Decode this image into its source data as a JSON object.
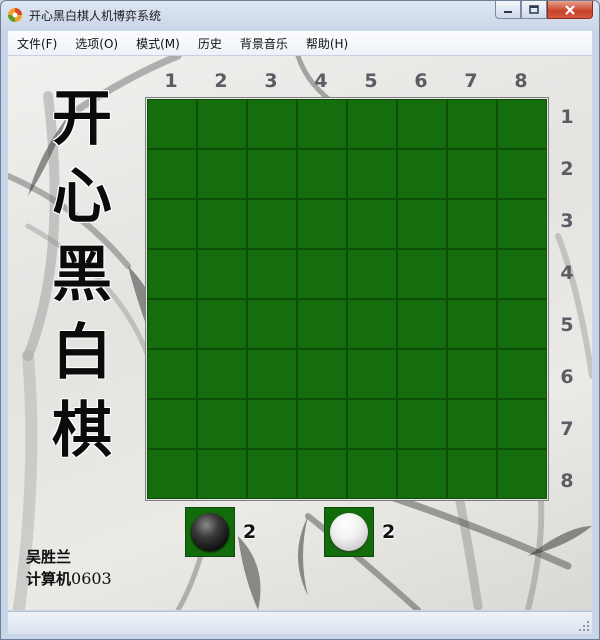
{
  "window": {
    "title": "开心黑白棋人机博弈系统",
    "icons": {
      "app": "orange-swirl-icon",
      "minimize": "minimize-icon",
      "maximize": "maximize-icon",
      "close": "close-icon"
    }
  },
  "menu": {
    "items": [
      "文件(F)",
      "选项(O)",
      "模式(M)",
      "历史",
      "背景音乐",
      "帮助(H)"
    ]
  },
  "sidebar": {
    "title_chars": [
      "开",
      "心",
      "黑",
      "白",
      "棋"
    ]
  },
  "board": {
    "size": 8,
    "column_labels": [
      "1",
      "2",
      "3",
      "4",
      "5",
      "6",
      "7",
      "8"
    ],
    "row_labels": [
      "1",
      "2",
      "3",
      "4",
      "5",
      "6",
      "7",
      "8"
    ],
    "color": "#136c0c"
  },
  "score": {
    "black": {
      "piece_icon": "black-piece-icon",
      "count": "2"
    },
    "white": {
      "piece_icon": "white-piece-icon",
      "count": "2"
    }
  },
  "author": {
    "name": "吴胜兰",
    "class_prefix": "计算机",
    "class_number": "0603"
  }
}
